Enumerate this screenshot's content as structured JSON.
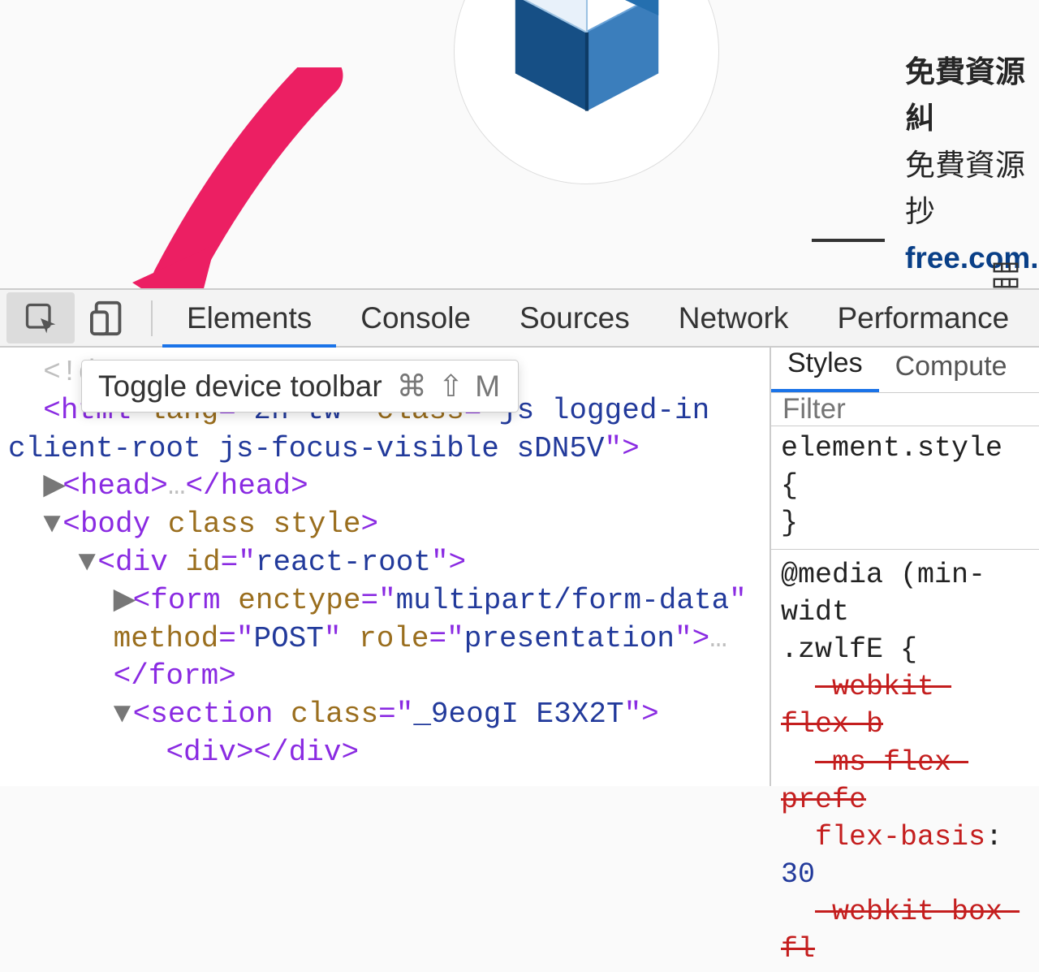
{
  "page": {
    "profile": {
      "title": "免費資源糾",
      "subtitle": "免費資源抄",
      "link": "free.com."
    }
  },
  "devtools": {
    "tabs": [
      "Elements",
      "Console",
      "Sources",
      "Network",
      "Performance"
    ],
    "active_tab": "Elements",
    "tooltip": {
      "label": "Toggle device toolbar",
      "shortcut": "⌘ ⇧ M"
    },
    "dom": {
      "l1": "<!d",
      "l2a": "<html ",
      "l2b": "lang",
      "l2c": "zh-tw",
      "l2d": "class",
      "l2e": "js logged-in ",
      "l3": "client-root js-focus-visible sDN5V",
      "l4": "<head>…</head>",
      "l5a": "<body ",
      "l5b": "class",
      "l5c": "style",
      "l6a": "<div ",
      "l6b": "id",
      "l6c": "react-root",
      "l7a": "<form ",
      "l7b": "enctype",
      "l7c": "multipart/form-data",
      "l8a": "method",
      "l8b": "POST",
      "l8c": "role",
      "l8d": "presentation",
      "l9": "</form>",
      "l10a": "<section ",
      "l10b": "class",
      "l10c": "_9eogI E3X2T",
      "l11": "<div></div>"
    },
    "styles": {
      "tabs": [
        "Styles",
        "Compute"
      ],
      "filter_placeholder": "Filter",
      "element_style_open": "element.style {",
      "element_style_close": "}",
      "media": "@media (min-widt",
      "selector": ".zwlfE {",
      "p1": "-webkit-flex-b",
      "p2": "-ms-flex-prefe",
      "p3_name": "flex-basis",
      "p3_val": "30",
      "p4": "-webkit-box-fl"
    }
  }
}
